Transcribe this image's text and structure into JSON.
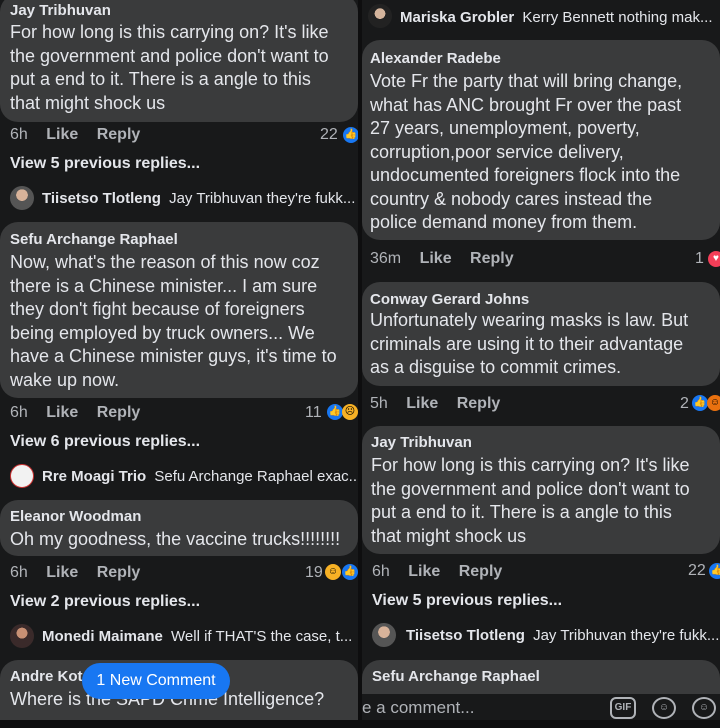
{
  "left": {
    "c1": {
      "name": "Jay Tribhuvan",
      "lines": [
        "For how long is this carrying on? It's like",
        "the government and police don't want to",
        "put a end to it. There is a angle to this",
        "that might shock us"
      ],
      "time": "6h",
      "like": "Like",
      "reply": "Reply",
      "reactions": "22"
    },
    "c1_more": "View 5 previous replies...",
    "c1_reply": {
      "name": "Tiisetso Tlotleng",
      "text": "Jay Tribhuvan they're fukk..."
    },
    "c2": {
      "name": "Sefu Archange Raphael",
      "lines": [
        "Now, what's the reason of this now coz",
        "there is a Chinese minister... I am sure",
        "they don't fight because of foreigners",
        "being employed by truck owners... We",
        "have a Chinese minister guys, it's time to",
        "wake up now."
      ],
      "time": "6h",
      "like": "Like",
      "reply": "Reply",
      "reactions": "11"
    },
    "c2_more": "View 6 previous replies...",
    "c2_reply": {
      "name": "Rre Moagi Trio",
      "text": "Sefu Archange Raphael exac..."
    },
    "c3": {
      "name": "Eleanor Woodman",
      "lines": [
        "Oh my goodness, the vaccine trucks!!!!!!!!"
      ],
      "time": "6h",
      "like": "Like",
      "reply": "Reply",
      "reactions": "19"
    },
    "c3_more": "View 2 previous replies...",
    "c3_reply": {
      "name": "Monedi Maimane",
      "text": "Well if THAT'S the case, t..."
    },
    "c4": {
      "name": "Andre Kot",
      "lines": [
        "Where is the SAPD Crime Intelligence?"
      ]
    },
    "new_comment": "1 New Comment"
  },
  "right": {
    "top_reply": {
      "name": "Mariska Grobler",
      "text": "Kerry Bennett nothing mak..."
    },
    "c1": {
      "name": "Alexander Radebe",
      "lines": [
        "Vote Fr the party that will bring change,",
        "what has ANC brought Fr over the past",
        "27 years, unemployment, poverty,",
        "corruption,poor service delivery,",
        "undocumented foreigners flock into the",
        "country  & nobody cares instead the",
        "police demand money from  them."
      ],
      "time": "36m",
      "like": "Like",
      "reply": "Reply",
      "reactions": "1"
    },
    "c2": {
      "name": "Conway Gerard Johns",
      "lines": [
        "Unfortunately wearing masks is law. But",
        "criminals are using it to their advantage",
        "as a disguise to commit crimes."
      ],
      "time": "5h",
      "like": "Like",
      "reply": "Reply",
      "reactions": "2"
    },
    "c3": {
      "name": "Jay Tribhuvan",
      "lines": [
        "For how long is this carrying on? It's like",
        "the government and police don't want to",
        "put a end to it. There is a angle to this",
        "that might shock us"
      ],
      "time": "6h",
      "like": "Like",
      "reply": "Reply",
      "reactions": "22"
    },
    "c3_more": "View 5 previous replies...",
    "c3_reply": {
      "name": "Tiisetso Tlotleng",
      "text": "Jay Tribhuvan they're fukk..."
    },
    "c4": {
      "name": "Sefu Archange Raphael"
    },
    "composer_placeholder": "e a comment...",
    "gif": "GIF"
  },
  "icons": {
    "like": "like-reaction-icon",
    "love": "love-reaction-icon",
    "haha": "haha-reaction-icon",
    "sad": "sad-reaction-icon",
    "sticker": "sticker-icon",
    "emoji": "emoji-icon",
    "gif": "gif-icon"
  },
  "colors": {
    "bubble": "#3a3b3c",
    "accent": "#1877f2",
    "background": "#18191a"
  }
}
